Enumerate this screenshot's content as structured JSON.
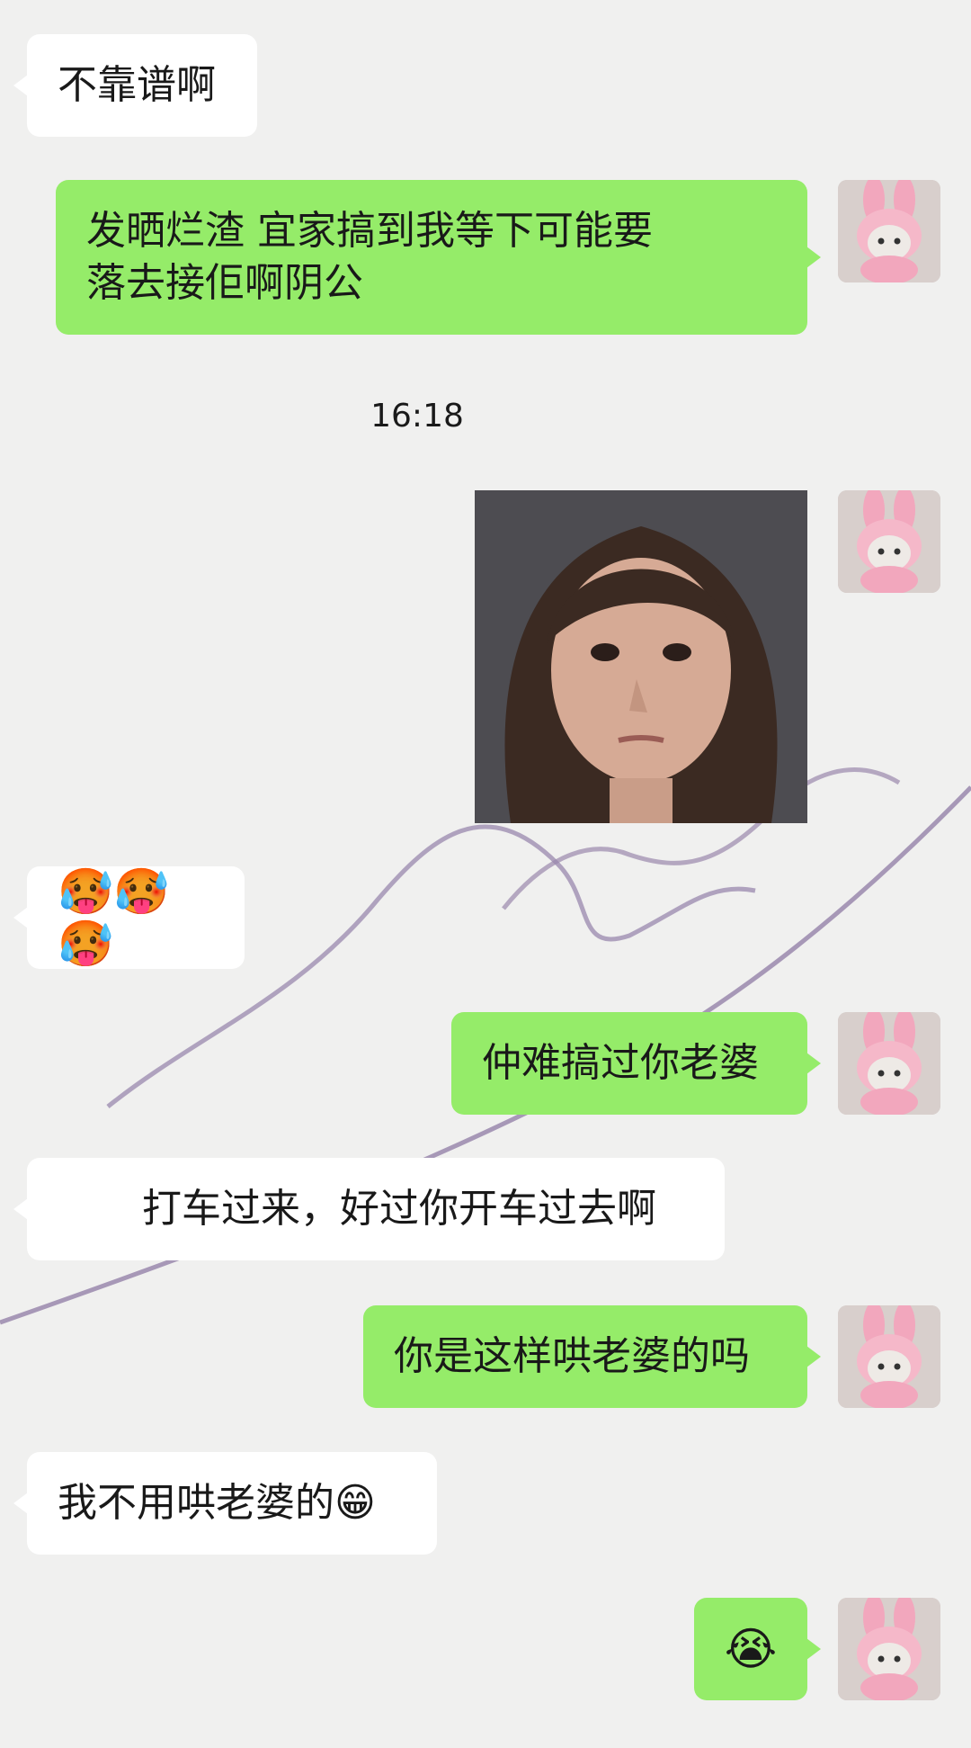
{
  "chat": {
    "timestamp": "16:18",
    "messages": [
      {
        "side": "in",
        "text": "不靠谱啊"
      },
      {
        "side": "out",
        "line1": "发晒烂渣 宜家搞到我等下可能要",
        "line2": "落去接佢啊阴公"
      },
      {
        "side": "out",
        "type": "image",
        "alt": "photo"
      },
      {
        "side": "in",
        "text": "🥵🥵🥵"
      },
      {
        "side": "out",
        "text": "仲难搞过你老婆"
      },
      {
        "side": "in",
        "text": "打车过来，好过你开车过去啊"
      },
      {
        "side": "out",
        "text": "你是这样哄老婆的吗"
      },
      {
        "side": "in",
        "text": "我不用哄老婆的😁"
      },
      {
        "side": "out",
        "text": "😭"
      }
    ]
  },
  "colors": {
    "outgoing_bubble": "#95ec69",
    "incoming_bubble": "#ffffff",
    "background": "#f0f0ef",
    "script_watermark": "#8c78a0"
  },
  "icons": {
    "avatar": "bunny-hat-cat-avatar"
  }
}
